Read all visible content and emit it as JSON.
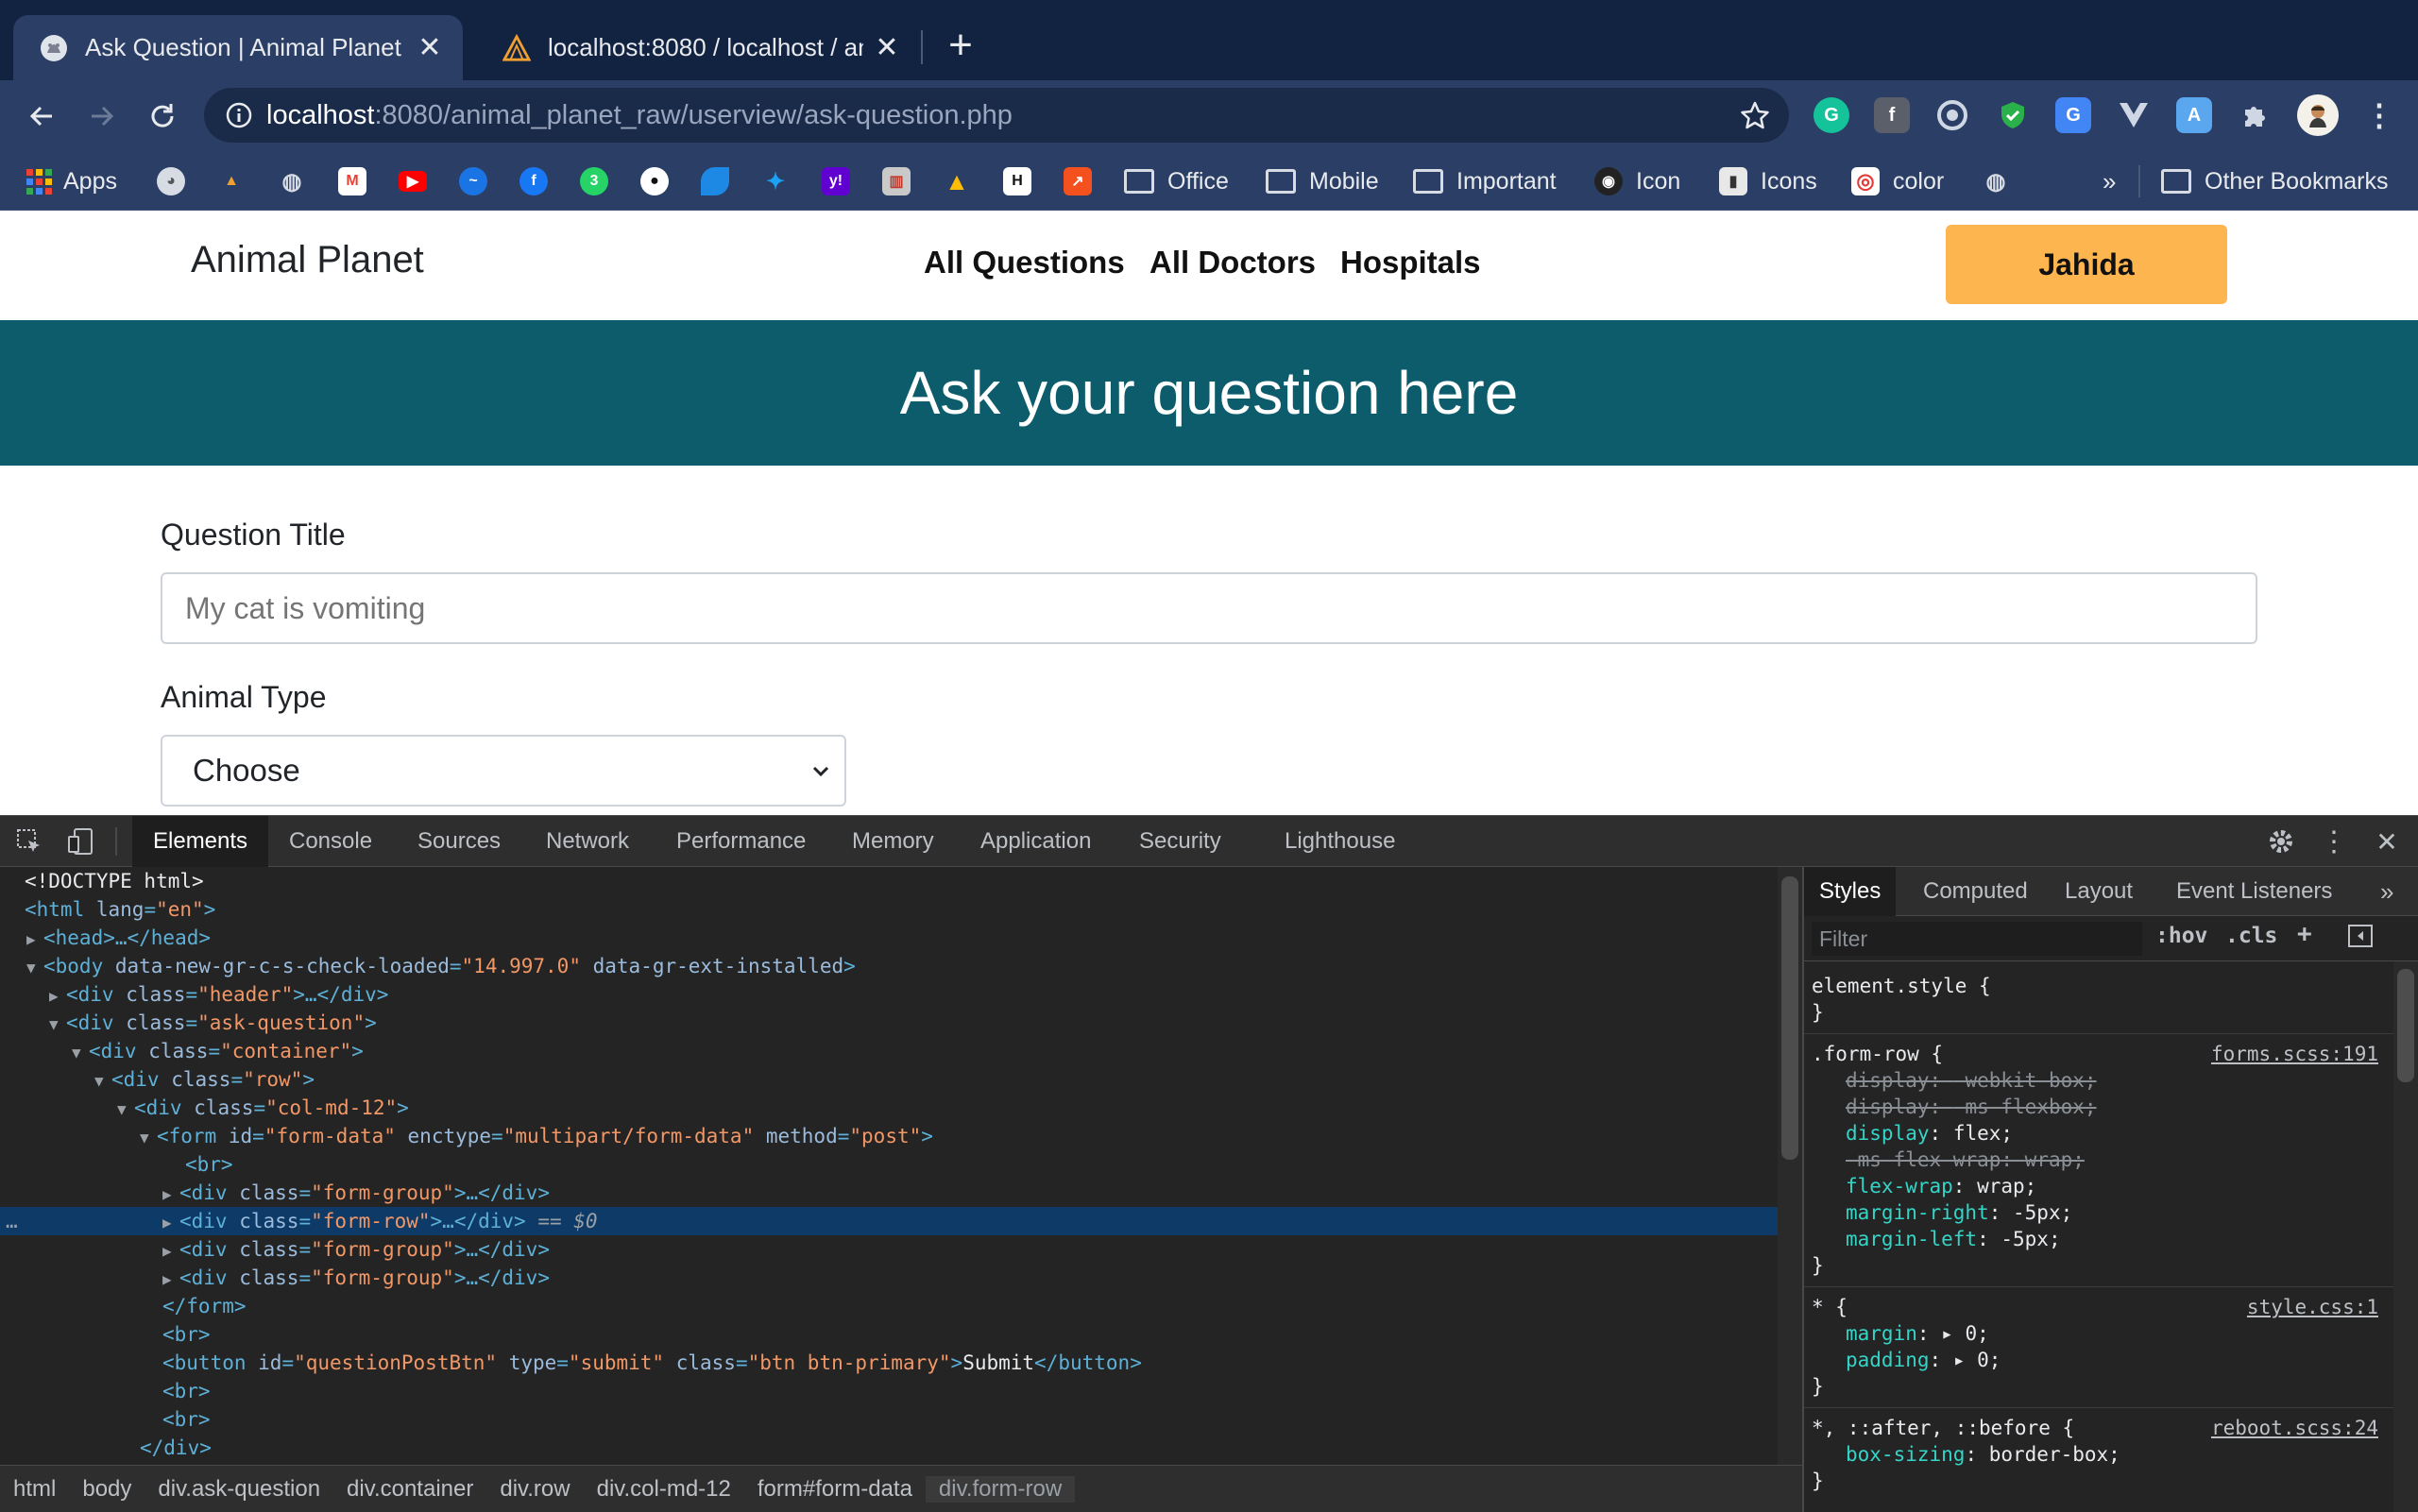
{
  "browser": {
    "tabs": [
      {
        "title": "Ask Question | Animal Planet",
        "active": true
      },
      {
        "title": "localhost:8080 / localhost / ani",
        "active": false
      }
    ],
    "new_tab": "+",
    "url": {
      "host": "localhost",
      "rest": ":8080/animal_planet_raw/userview/ask-question.php"
    },
    "bookmarks": {
      "apps": "Apps",
      "office": "Office",
      "mobile": "Mobile",
      "important": "Important",
      "icon": "Icon",
      "icons": "Icons",
      "color": "color",
      "more": "»",
      "other": "Other Bookmarks"
    }
  },
  "site": {
    "logo": "Animal Planet",
    "nav": [
      "All Questions",
      "All Doctors",
      "Hospitals"
    ],
    "user_button": "Jahida",
    "banner": "Ask your question here",
    "form": {
      "title_label": "Question Title",
      "title_placeholder": "My cat is vomiting",
      "animal_label": "Animal Type",
      "animal_selected": "Choose"
    }
  },
  "devtools": {
    "tabs": [
      "Elements",
      "Console",
      "Sources",
      "Network",
      "Performance",
      "Memory",
      "Application",
      "Security",
      "Lighthouse"
    ],
    "selected_tab": "Elements",
    "dom": {
      "doctype": "<!DOCTYPE html>",
      "html_open": {
        "tag": "<html ",
        "attr": "lang",
        "val": "\"en\"",
        "close": ">"
      },
      "head": "<head>…</head>",
      "body": {
        "tag": "<body ",
        "a1": "data-new-gr-c-s-check-loaded",
        "v1": "\"14.997.0\"",
        "a2": " data-gr-ext-installed",
        "close": ">"
      },
      "header_div": {
        "tag": "<div ",
        "attr": "class",
        "val": "\"header\"",
        "close": ">…</div>"
      },
      "ask_div": {
        "tag": "<div ",
        "attr": "class",
        "val": "\"ask-question\"",
        "close": ">"
      },
      "container_div": {
        "tag": "<div ",
        "attr": "class",
        "val": "\"container\"",
        "close": ">"
      },
      "row_div": {
        "tag": "<div ",
        "attr": "class",
        "val": "\"row\"",
        "close": ">"
      },
      "col_div": {
        "tag": "<div ",
        "attr": "class",
        "val": "\"col-md-12\"",
        "close": ">"
      },
      "form": {
        "tag": "<form ",
        "a1": "id",
        "v1": "\"form-data\"",
        "a2": " enctype",
        "v2": "\"multipart/form-data\"",
        "a3": " method",
        "v3": "\"post\"",
        "close": ">"
      },
      "br": "<br>",
      "form_group": {
        "tag": "<div ",
        "attr": "class",
        "val": "\"form-group\"",
        "close": ">…</div>"
      },
      "form_row": {
        "tag": "<div ",
        "attr": "class",
        "val": "\"form-row\"",
        "close": ">…</div>",
        "marker": " == $0"
      },
      "form_close": "</form>",
      "button": {
        "tag": "<button ",
        "a1": "id",
        "v1": "\"questionPostBtn\"",
        "a2": " type",
        "v2": "\"submit\"",
        "a3": " class",
        "v3": "\"btn btn-primary\"",
        "text": "Submit",
        "close": "</button>"
      },
      "div_close": "</div>",
      "ellipsis": "…"
    },
    "breadcrumb": [
      "html",
      "body",
      "div.ask-question",
      "div.container",
      "div.row",
      "div.col-md-12",
      "form#form-data",
      "div.form-row"
    ],
    "styles": {
      "tabs": [
        "Styles",
        "Computed",
        "Layout",
        "Event Listeners"
      ],
      "more": "»",
      "filter_placeholder": "Filter",
      "hov": ":hov",
      "cls": ".cls",
      "element_style": "element.style {",
      "close_brace": "}",
      "form_row_rule": {
        "selector": ".form-row {",
        "source": "forms.scss:191",
        "props": [
          {
            "name": "display",
            "value": "-webkit-box;",
            "struck": true
          },
          {
            "name": "display",
            "value": "-ms-flexbox;",
            "struck": true
          },
          {
            "name": "display",
            "value": "flex;",
            "struck": false
          },
          {
            "name": "-ms-flex-wrap",
            "value": "wrap;",
            "struck": true
          },
          {
            "name": "flex-wrap",
            "value": "wrap;",
            "struck": false
          },
          {
            "name": "margin-right",
            "value": "-5px;",
            "struck": false
          },
          {
            "name": "margin-left",
            "value": "-5px;",
            "struck": false
          }
        ]
      },
      "star_rule": {
        "selector": "* {",
        "source": "style.css:1",
        "props": [
          {
            "name": "margin",
            "value": "▸ 0;"
          },
          {
            "name": "padding",
            "value": "▸ 0;"
          }
        ]
      },
      "reboot_rule": {
        "selector": "*, ::after, ::before {",
        "source": "reboot.scss:24",
        "props": [
          {
            "name": "box-sizing",
            "value": "border-box;"
          }
        ]
      }
    }
  }
}
